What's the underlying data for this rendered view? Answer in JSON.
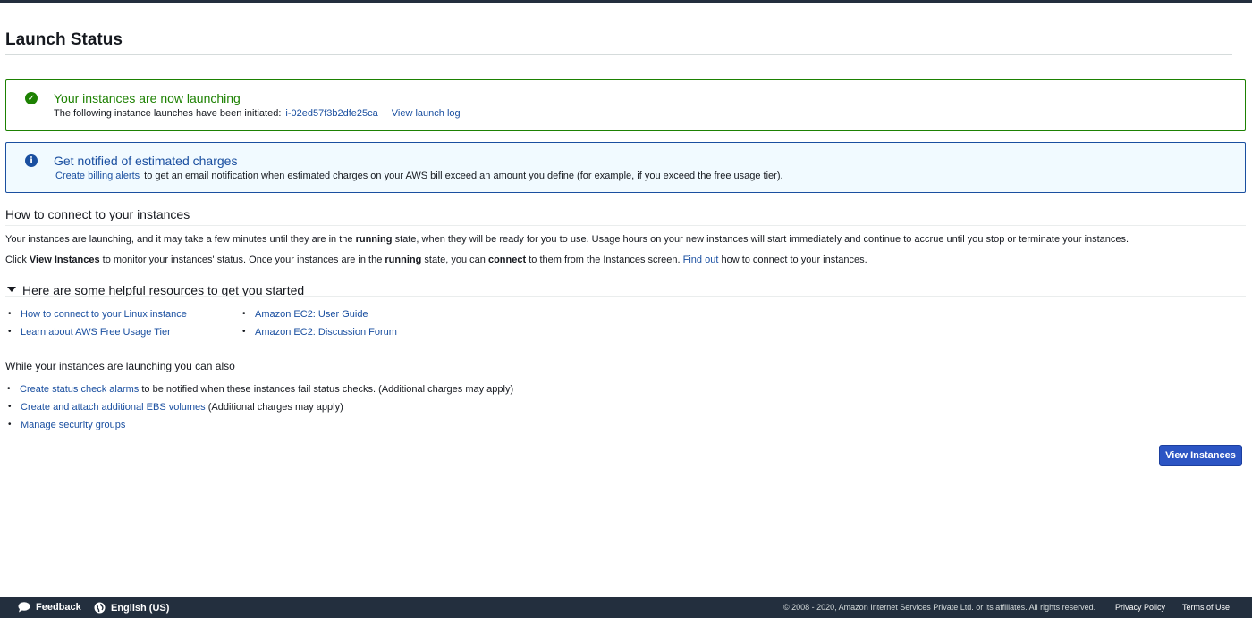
{
  "page": {
    "title": "Launch Status"
  },
  "success_alert": {
    "title": "Your instances are now launching",
    "body": "The following instance launches have been initiated:",
    "instance_id": "i-02ed57f3b2dfe25ca",
    "view_log": "View launch log"
  },
  "info_alert": {
    "title": "Get notified of estimated charges",
    "link": "Create billing alerts",
    "body": "to get an email notification when estimated charges on your AWS bill exceed an amount you define (for example, if you exceed the free usage tier)."
  },
  "connect_section": {
    "title": "How to connect to your instances",
    "p1_a": "Your instances are launching, and it may take a few minutes until they are in the",
    "p1_bold": "running",
    "p1_b": "state, when they will be ready for you to use. Usage hours on your new instances will start immediately and continue to accrue until you stop or terminate your instances.",
    "p2_a": "Click",
    "p2_bold1": "View Instances",
    "p2_b": "to monitor your instances' status. Once your instances are in the",
    "p2_bold2": "running",
    "p2_c": "state, you can",
    "p2_bold3": "connect",
    "p2_d": "to them from the Instances screen.",
    "p2_link": "Find out",
    "p2_e": "how to connect to your instances."
  },
  "resources": {
    "title": "Here are some helpful resources to get you started",
    "col1": [
      "How to connect to your Linux instance",
      "Learn about AWS Free Usage Tier"
    ],
    "col2": [
      "Amazon EC2: User Guide",
      "Amazon EC2: Discussion Forum"
    ]
  },
  "also": {
    "title": "While your instances are launching you can also",
    "item1_link": "Create status check alarms",
    "item1_text": "to be notified when these instances fail status checks. (Additional charges may apply)",
    "item2_link": "Create and attach additional EBS volumes",
    "item2_text": "(Additional charges may apply)",
    "item3_link": "Manage security groups"
  },
  "actions": {
    "view_instances": "View Instances"
  },
  "footer": {
    "feedback": "Feedback",
    "language": "English (US)",
    "copyright": "© 2008 - 2020, Amazon Internet Services Private Ltd. or its affiliates. All rights reserved.",
    "privacy": "Privacy Policy",
    "terms": "Terms of Use"
  },
  "colors": {
    "success": "#1d8102",
    "info": "#1a4fa0",
    "link": "#1a4fa0",
    "button": "#2c55c4",
    "footer_bg": "#232f3e"
  }
}
